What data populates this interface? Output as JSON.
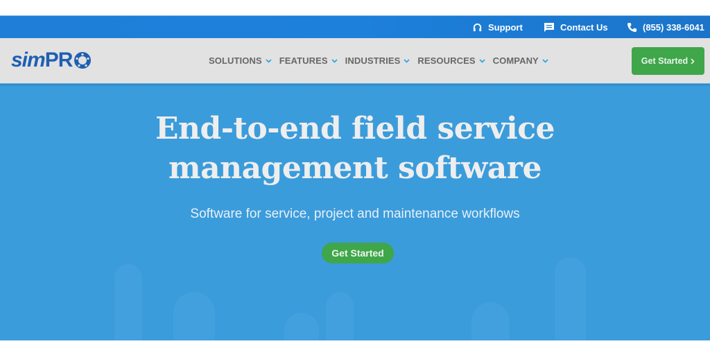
{
  "utility_bar": {
    "items": [
      {
        "icon": "headset-icon",
        "label": "Support"
      },
      {
        "icon": "chat-icon",
        "label": "Contact Us"
      },
      {
        "icon": "phone-icon",
        "label": "(855) 338-6041"
      }
    ]
  },
  "brand": {
    "logo_text_main": "sim",
    "logo_text_pro": "PR",
    "logo_color": "#1e5fb3"
  },
  "nav": {
    "items": [
      {
        "label": "SOLUTIONS"
      },
      {
        "label": "FEATURES"
      },
      {
        "label": "INDUSTRIES"
      },
      {
        "label": "RESOURCES"
      },
      {
        "label": "COMPANY"
      }
    ],
    "cta_label": "Get Started",
    "chevron_color": "#2aa8e0"
  },
  "hero": {
    "title_line1": "End-to-end field service",
    "title_line2": "management software",
    "subtitle": "Software for service, project and maintenance workflows",
    "cta_label": "Get Started",
    "background_color": "#3b9cdb",
    "cta_color": "#3fa64a"
  }
}
